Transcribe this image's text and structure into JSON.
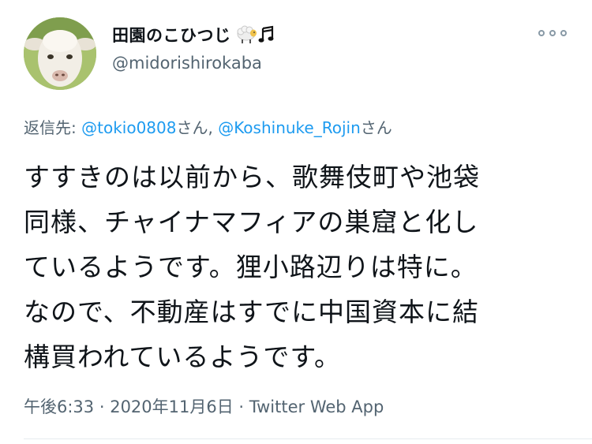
{
  "user": {
    "display_name": "田園のこひつじ",
    "handle": "@midorishirokaba",
    "avatar_icon": "lamb-avatar",
    "name_icons": [
      "sheep-icon",
      "music-note-icon"
    ]
  },
  "reply": {
    "prefix": "返信先: ",
    "mention1": "@tokio0808",
    "suffix1": "さん, ",
    "mention2": "@Koshinuke_Rojin",
    "suffix2": "さん"
  },
  "tweet": {
    "lines": [
      "すすきのは以前から、歌舞伎町や池袋",
      "同様、チャイナマフィアの巣窟と化し",
      "ているようです。狸小路辺りは特に。",
      "なので、不動産はすでに中国資本に結",
      "構買われているようです。"
    ]
  },
  "meta": {
    "time": "午後6:33",
    "separator": " · ",
    "date": "2020年11月6日",
    "source": "Twitter Web App"
  },
  "colors": {
    "link": "#1d9bf0",
    "secondary_text": "#536471",
    "primary_text": "#0f1419"
  },
  "more_icon": "more-options-icon"
}
